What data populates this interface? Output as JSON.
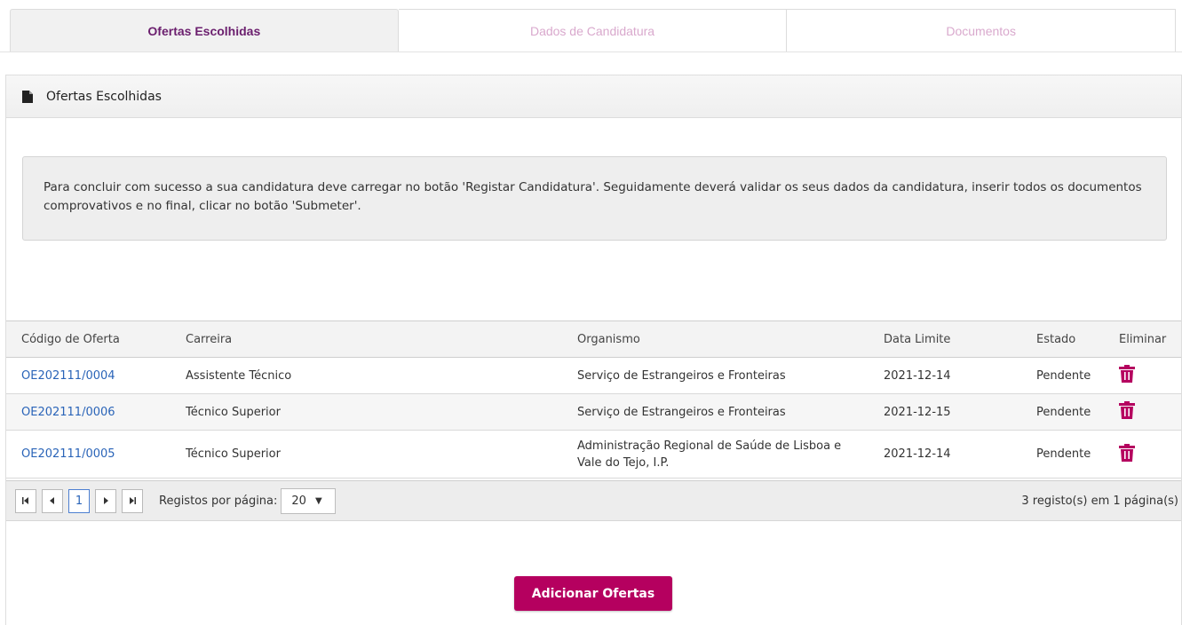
{
  "tabs": [
    {
      "label": "Ofertas Escolhidas",
      "active": true
    },
    {
      "label": "Dados de Candidatura",
      "active": false
    },
    {
      "label": "Documentos",
      "active": false
    }
  ],
  "panel": {
    "title": "Ofertas Escolhidas",
    "icon": "document-icon",
    "info_text": "Para concluir com sucesso a sua candidatura deve carregar no botão 'Registar Candidatura'. Seguidamente deverá validar os seus dados da candidatura, inserir todos os documentos comprovativos e no final, clicar no botão 'Submeter'."
  },
  "grid": {
    "columns": [
      "Código de Oferta",
      "Carreira",
      "Organismo",
      "Data Limite",
      "Estado",
      "Eliminar"
    ],
    "rows": [
      {
        "code": "OE202111/0004",
        "career": "Assistente Técnico",
        "organism": "Serviço de Estrangeiros e Fronteiras",
        "deadline": "2021-12-14",
        "status": "Pendente"
      },
      {
        "code": "OE202111/0006",
        "career": "Técnico Superior",
        "organism": "Serviço de Estrangeiros e Fronteiras",
        "deadline": "2021-12-15",
        "status": "Pendente"
      },
      {
        "code": "OE202111/0005",
        "career": "Técnico Superior",
        "organism": "Administração Regional de Saúde de Lisboa e Vale do Tejo, I.P.",
        "deadline": "2021-12-14",
        "status": "Pendente"
      }
    ],
    "delete_icon": "trash-icon"
  },
  "pager": {
    "current_page": "1",
    "page_size_label": "Registos por página:",
    "page_size": "20",
    "info": "3 registo(s) em 1 página(s)"
  },
  "actions": {
    "add_label": "Adicionar Ofertas"
  },
  "colors": {
    "brand": "#b5005f",
    "active_tab_text": "#6b1f6e",
    "link": "#2a64b8",
    "inactive_tab_text": "#d9a9cd"
  }
}
